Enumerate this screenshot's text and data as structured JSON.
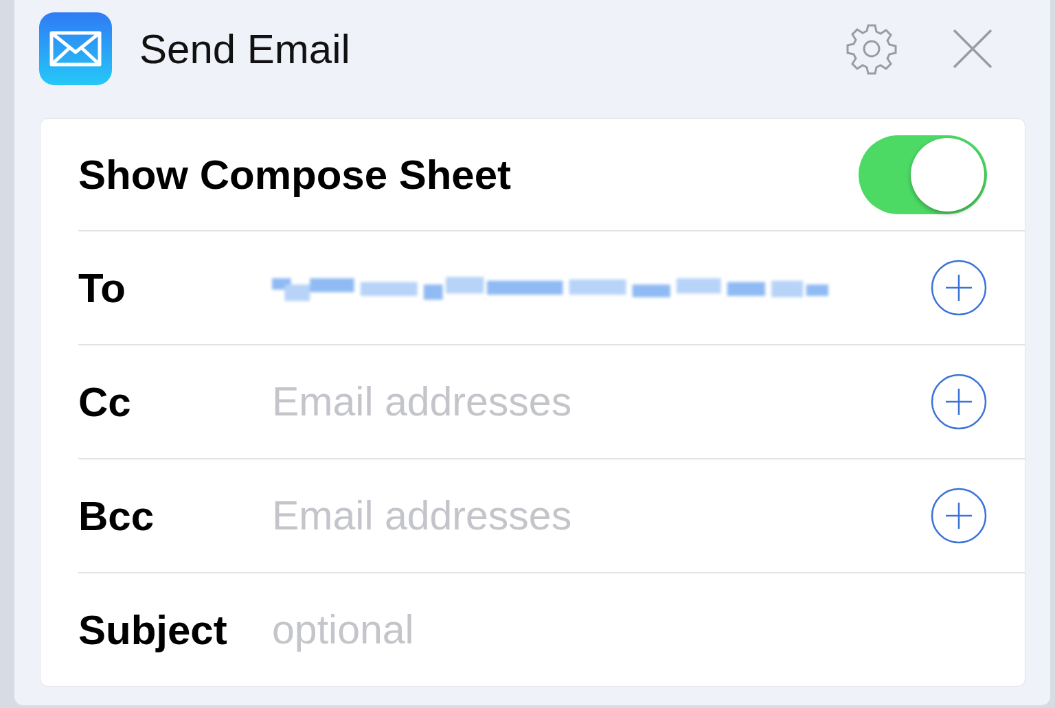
{
  "action": {
    "title": "Send Email"
  },
  "rows": [
    {
      "kind": "toggle",
      "label": "Show Compose Sheet",
      "on": true
    },
    {
      "kind": "field",
      "label": "To",
      "redacted": true,
      "add_button": true
    },
    {
      "kind": "field",
      "label": "Cc",
      "placeholder": "Email addresses",
      "add_button": true
    },
    {
      "kind": "field",
      "label": "Bcc",
      "placeholder": "Email addresses",
      "add_button": true
    },
    {
      "kind": "field",
      "label": "Subject",
      "placeholder": "optional",
      "add_button": false
    }
  ]
}
